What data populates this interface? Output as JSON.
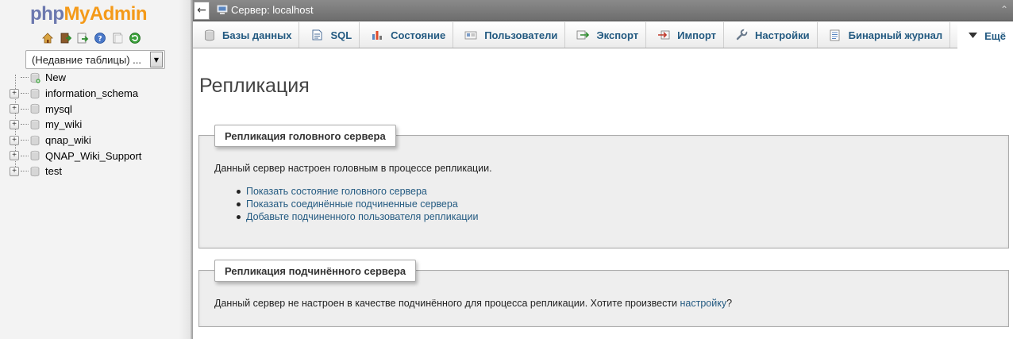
{
  "logo": {
    "part1": "php",
    "part2": "MyAdmin"
  },
  "quick_icons": [
    "home-icon",
    "exit-icon",
    "query-window-icon",
    "help-icon",
    "docs-icon",
    "reload-icon"
  ],
  "recent_tables": {
    "selected": "(Недавние таблицы) ..."
  },
  "databases": [
    {
      "name": "New",
      "expandable": false
    },
    {
      "name": "information_schema",
      "expandable": true
    },
    {
      "name": "mysql",
      "expandable": true
    },
    {
      "name": "my_wiki",
      "expandable": true
    },
    {
      "name": "qnap_wiki",
      "expandable": true
    },
    {
      "name": "QNAP_Wiki_Support",
      "expandable": true
    },
    {
      "name": "test",
      "expandable": true
    }
  ],
  "topbar": {
    "server_label": "Сервер: localhost"
  },
  "tabs": [
    {
      "label": "Базы данных",
      "icon": "databases-icon"
    },
    {
      "label": "SQL",
      "icon": "sql-icon"
    },
    {
      "label": "Состояние",
      "icon": "status-icon"
    },
    {
      "label": "Пользователи",
      "icon": "users-icon"
    },
    {
      "label": "Экспорт",
      "icon": "export-icon"
    },
    {
      "label": "Импорт",
      "icon": "import-icon"
    },
    {
      "label": "Настройки",
      "icon": "settings-icon"
    },
    {
      "label": "Бинарный журнал",
      "icon": "binlog-icon"
    },
    {
      "label": "Ещё",
      "icon": "more-icon"
    }
  ],
  "page": {
    "title": "Репликация",
    "master": {
      "legend": "Репликация головного сервера",
      "description": "Данный сервер настроен головным в процессе репликации.",
      "links": [
        "Показать состояние головного сервера",
        "Показать соединённые подчиненные сервера",
        "Добавьте подчиненного пользователя репликации"
      ]
    },
    "slave": {
      "legend": "Репликация подчинённого сервера",
      "description_before": "Данный сервер не настроен в качестве подчинённого для процесса репликации. Хотите произвести ",
      "link": "настройку",
      "description_after": "?"
    }
  },
  "colors": {
    "link": "#235a81",
    "logo_php": "#6c78af",
    "logo_admin": "#f49a19",
    "topbar": "#7a7a7a"
  }
}
